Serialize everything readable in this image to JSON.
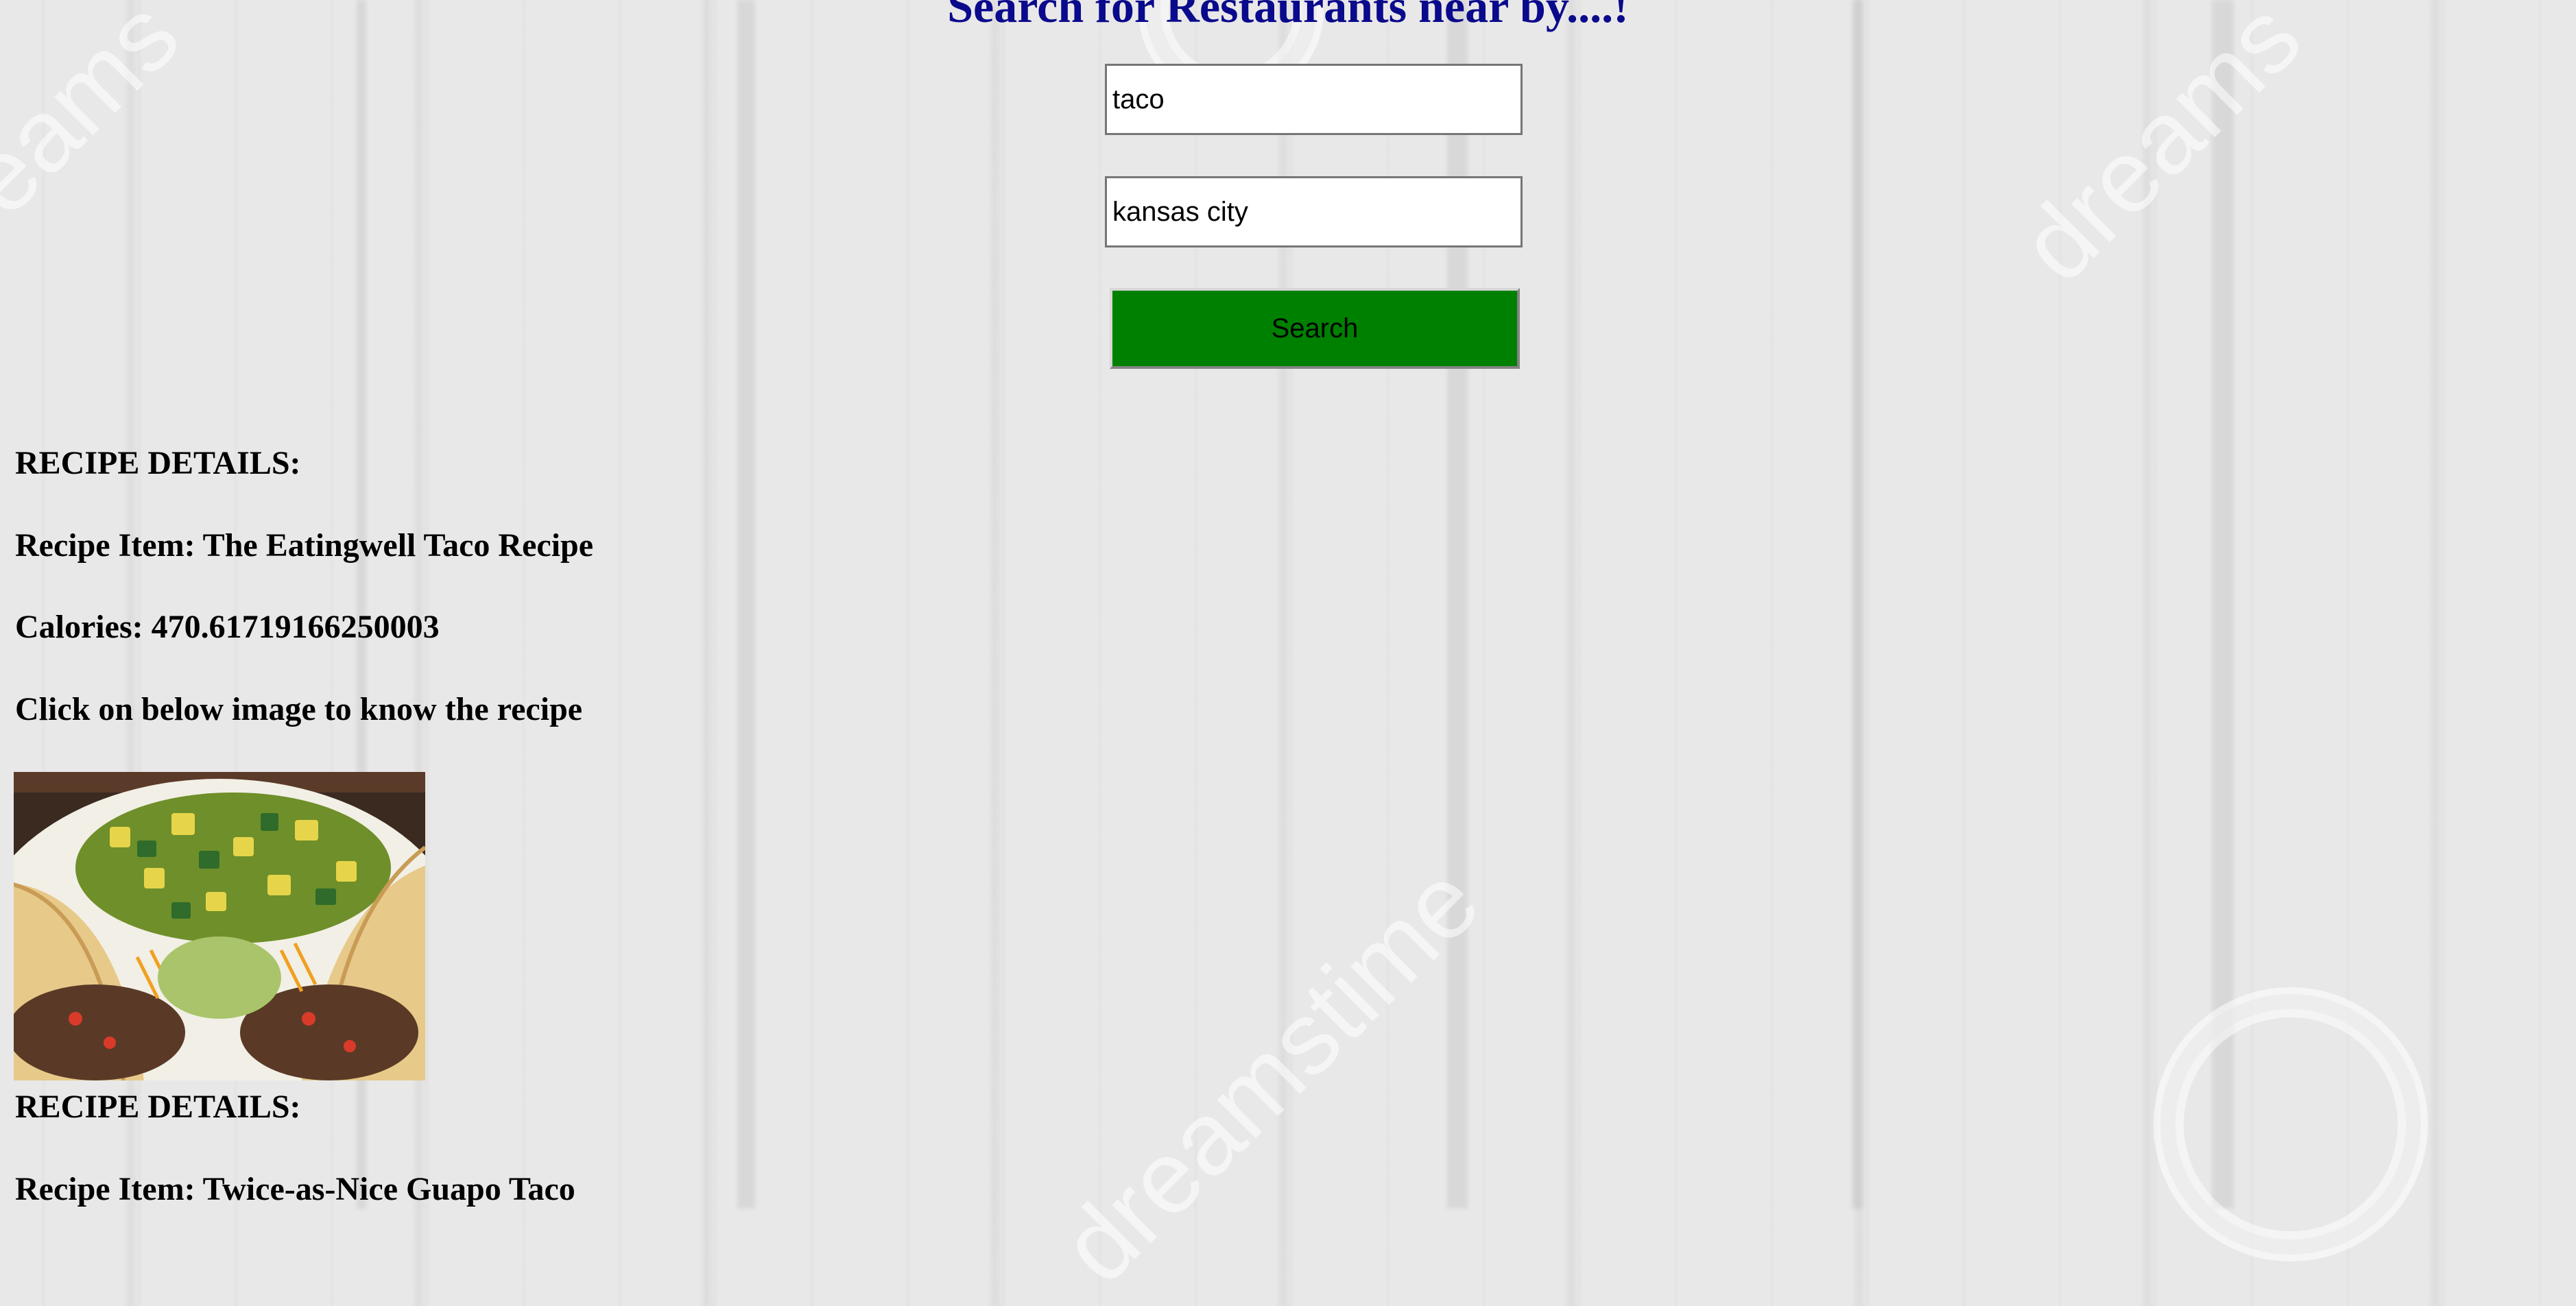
{
  "page": {
    "title": "Search for Restaurants near by....!"
  },
  "search": {
    "food_value": "taco",
    "location_value": "kansas city",
    "button_label": "Search"
  },
  "recipes": [
    {
      "header": "RECIPE DETAILS:",
      "item": "Recipe Item: The Eatingwell Taco Recipe",
      "calories": "Calories: 470.61719166250003",
      "instruction": "Click on below image to know the recipe"
    },
    {
      "header": "RECIPE DETAILS:",
      "item": "Recipe Item: Twice-as-Nice Guapo Taco"
    }
  ],
  "colors": {
    "title": "#0a0a8c",
    "button": "#008000",
    "background": "#e9e8e8"
  }
}
